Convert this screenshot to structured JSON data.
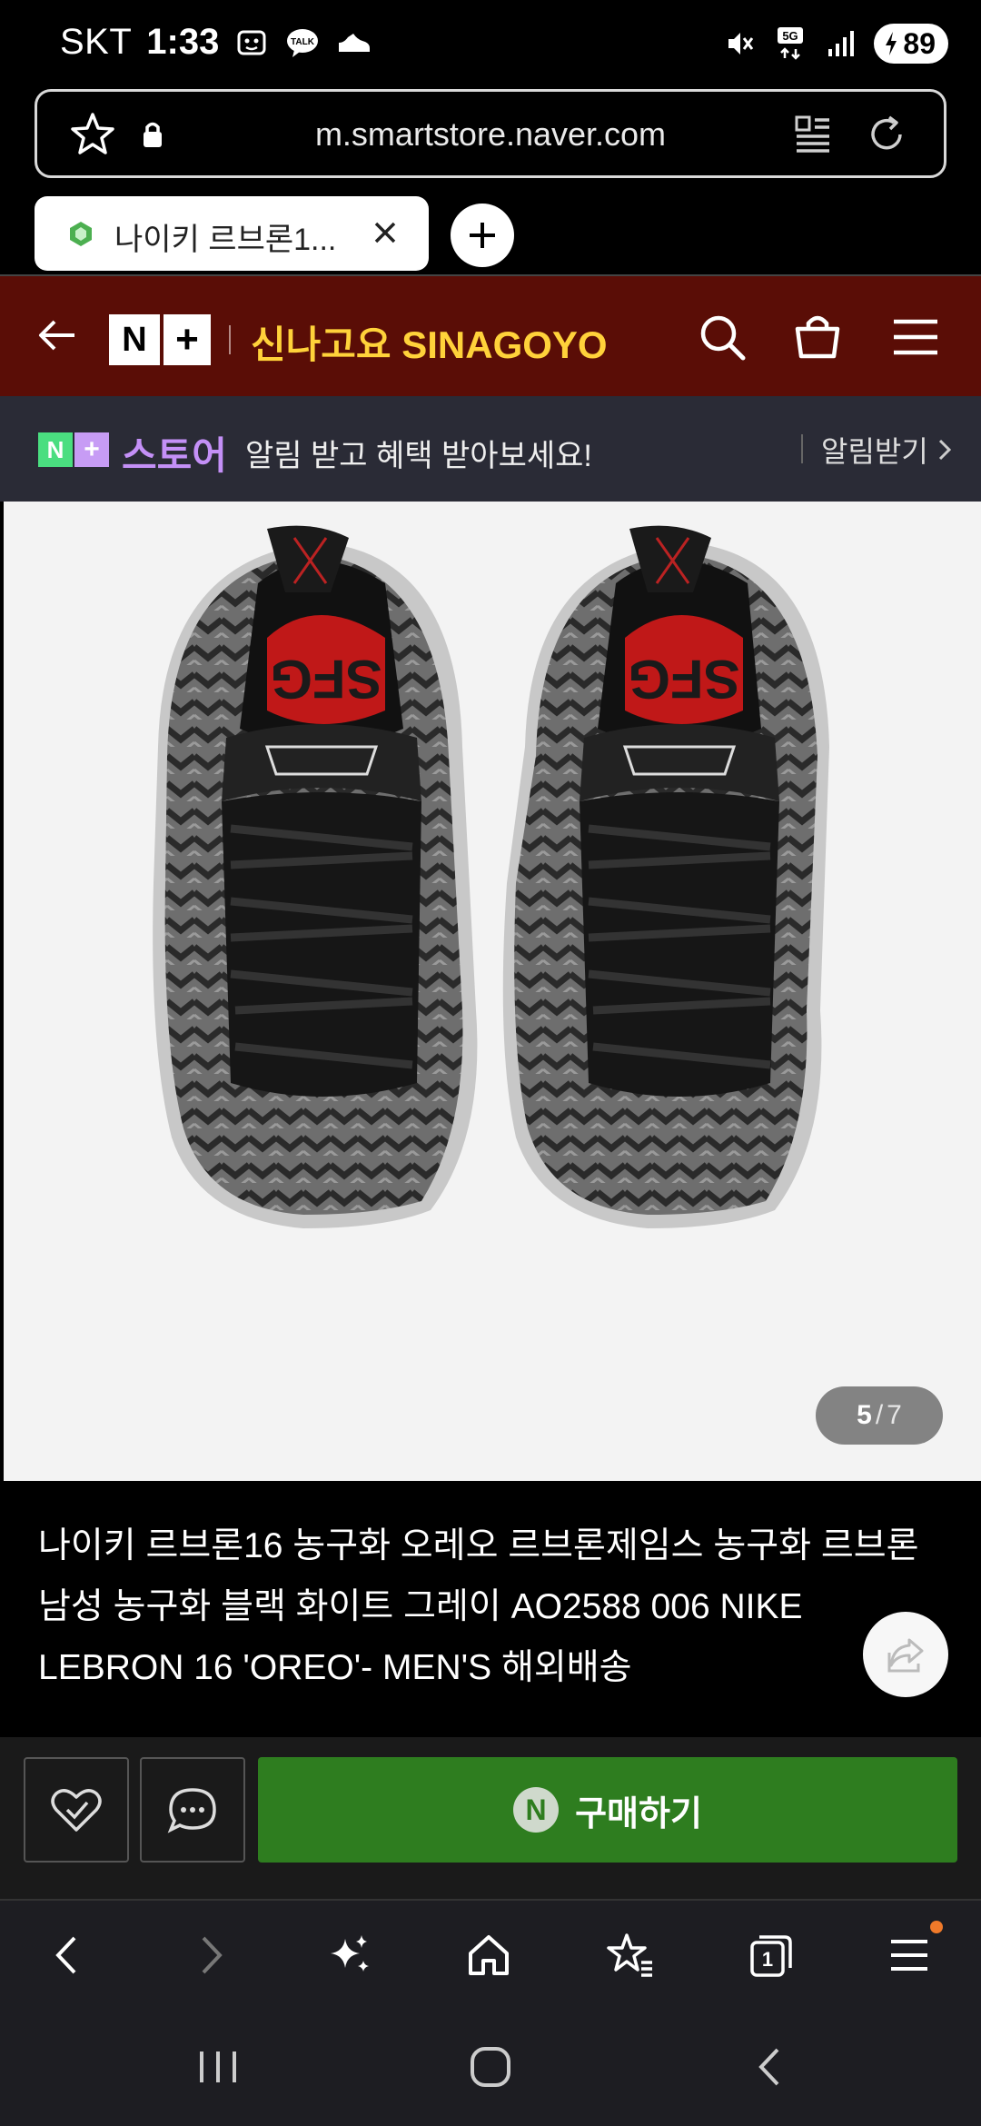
{
  "status_bar": {
    "carrier": "SKT",
    "time": "1:33",
    "notification_icons": [
      "screenshot-icon",
      "talk-icon",
      "shoe-icon"
    ],
    "system_icons": [
      "mute-icon",
      "5g-icon",
      "signal-icon"
    ],
    "battery": "89"
  },
  "browser": {
    "url": "m.smartstore.naver.com",
    "tab_title": "나이키 르브론1...",
    "new_tab_symbol": "+"
  },
  "store_header": {
    "store_name": "신나고요 SINAGOYO",
    "logo_n": "N",
    "logo_plus": "+"
  },
  "notify_banner": {
    "brand_n": "N",
    "brand_plus": "+",
    "brand_word": "스토어",
    "message": "알림 받고 혜택 받아보세요!",
    "button_label": "알림받기"
  },
  "gallery": {
    "current": "5",
    "separator": "/",
    "total": "7"
  },
  "product": {
    "title": "나이키 르브론16 농구화 오레오 르브론제임스 농구화 르브론 남성 농구화 블랙 화이트 그레이 AO2588 006 NIKE LEBRON 16 'OREO'- MEN'S 해외배송"
  },
  "purchase_bar": {
    "buy_badge": "N",
    "buy_label": "구매하기"
  },
  "bottom_nav": {
    "tab_count": "1"
  },
  "colors": {
    "store_header_bg": "#5a0d06",
    "store_name": "#ffd23a",
    "buy_button": "#2e7d1f",
    "notify_bg": "#2a2b36",
    "store_word": "#c490f7"
  }
}
